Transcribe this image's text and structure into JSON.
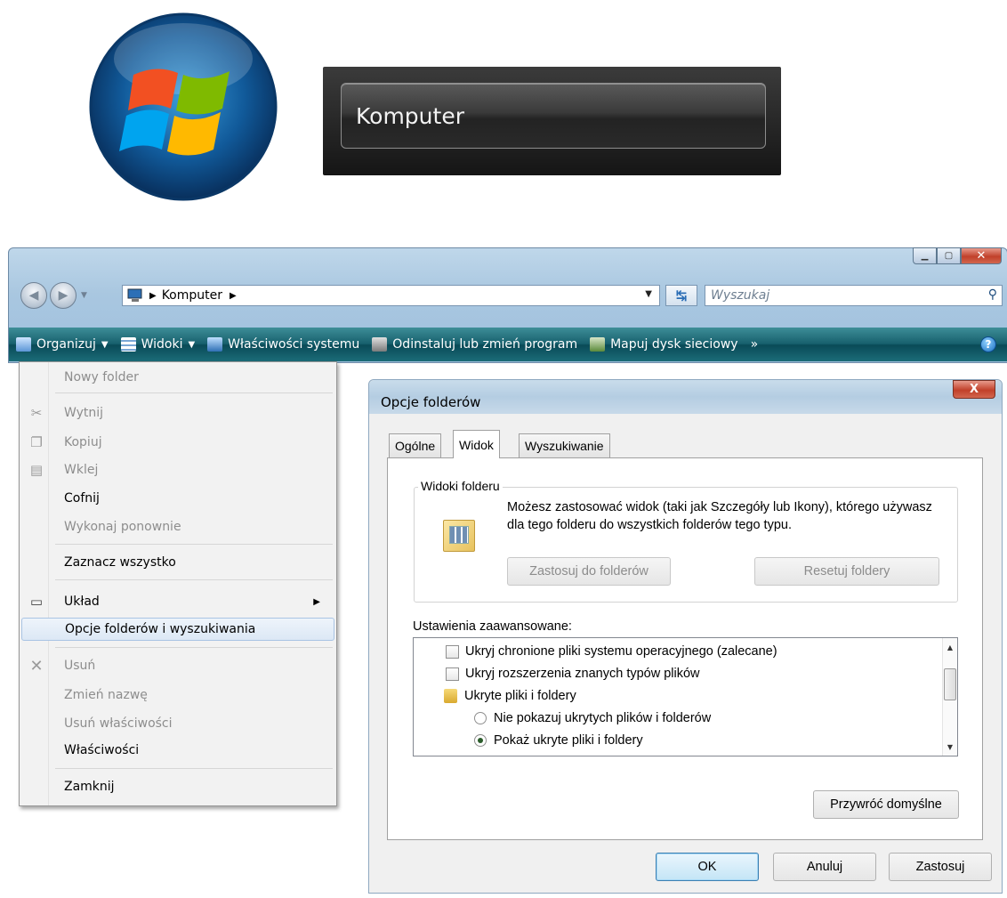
{
  "banner": {
    "title": "Komputer"
  },
  "window": {
    "address_crumbs": [
      "Komputer"
    ],
    "search_placeholder": "Wyszukaj",
    "commands": [
      {
        "label": "Organizuj",
        "icon": "organize-icon",
        "has_arrow": true
      },
      {
        "label": "Widoki",
        "icon": "views-icon",
        "has_arrow": true
      },
      {
        "label": "Właściwości systemu",
        "icon": "system-properties-icon",
        "has_arrow": false
      },
      {
        "label": "Odinstaluj lub zmień program",
        "icon": "uninstall-program-icon",
        "has_arrow": false
      },
      {
        "label": "Mapuj dysk sieciowy",
        "icon": "map-network-drive-icon",
        "has_arrow": false
      }
    ],
    "overflow_glyph": "»",
    "help_glyph": "?"
  },
  "menu": {
    "items": [
      {
        "label": "Nowy folder",
        "disabled": true
      },
      {
        "label": "Wytnij",
        "disabled": true,
        "icon": "cut-icon"
      },
      {
        "label": "Kopiuj",
        "disabled": true,
        "icon": "copy-icon"
      },
      {
        "label": "Wklej",
        "disabled": true,
        "icon": "paste-icon"
      },
      {
        "label": "Cofnij",
        "disabled": false
      },
      {
        "label": "Wykonaj ponownie",
        "disabled": true
      },
      {
        "label": "Zaznacz wszystko",
        "disabled": false
      },
      {
        "label": "Układ",
        "disabled": false,
        "icon": "layout-icon",
        "submenu": true
      },
      {
        "label": "Opcje folderów i wyszukiwania",
        "disabled": false,
        "highlighted": true
      },
      {
        "label": "Usuń",
        "disabled": true,
        "icon": "delete-icon"
      },
      {
        "label": "Zmień nazwę",
        "disabled": true
      },
      {
        "label": "Usuń właściwości",
        "disabled": true
      },
      {
        "label": "Właściwości",
        "disabled": false
      },
      {
        "label": "Zamknij",
        "disabled": false
      }
    ]
  },
  "dialog": {
    "title": "Opcje folderów",
    "close_glyph": "X",
    "tabs": [
      {
        "label": "Ogólne",
        "active": false
      },
      {
        "label": "Widok",
        "active": true
      },
      {
        "label": "Wyszukiwanie",
        "active": false
      }
    ],
    "folder_views": {
      "group_title": "Widoki folderu",
      "description": "Możesz zastosować widok (taki jak Szczegóły lub Ikony), którego używasz dla tego folderu do wszystkich folderów tego typu.",
      "apply_button": "Zastosuj do folderów",
      "reset_button": "Resetuj foldery"
    },
    "advanced": {
      "label": "Ustawienia zaawansowane:",
      "rows": [
        {
          "type": "checkbox",
          "label": "Ukryj chronione pliki systemu operacyjnego (zalecane)",
          "checked": false
        },
        {
          "type": "checkbox",
          "label": "Ukryj rozszerzenia znanych typów plików",
          "checked": false
        },
        {
          "type": "folder",
          "label": "Ukryte pliki i foldery"
        },
        {
          "type": "radio",
          "label": "Nie pokazuj ukrytych plików i folderów",
          "checked": false
        },
        {
          "type": "radio",
          "label": "Pokaż ukryte pliki i foldery",
          "checked": true
        }
      ]
    },
    "restore_button": "Przywróć domyślne",
    "ok_button": "OK",
    "cancel_button": "Anuluj",
    "apply_button": "Zastosuj"
  }
}
